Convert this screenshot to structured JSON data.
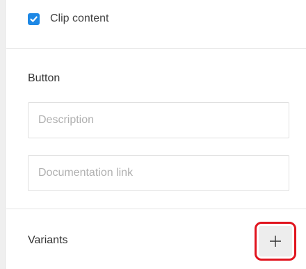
{
  "clip_content": {
    "label": "Clip content",
    "checked": true
  },
  "button_section": {
    "title": "Button",
    "description_placeholder": "Description",
    "documentation_placeholder": "Documentation link"
  },
  "variants_section": {
    "title": "Variants",
    "add_icon": "plus-icon"
  },
  "colors": {
    "checkbox": "#1e88e5",
    "highlight": "#e0141e"
  }
}
